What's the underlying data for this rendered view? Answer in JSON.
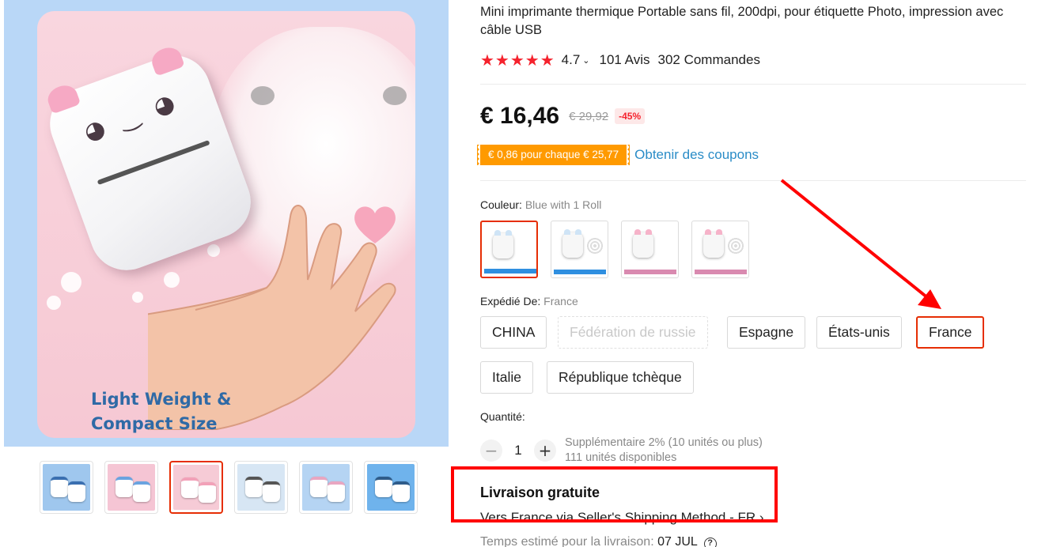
{
  "gallery": {
    "caption_line1": "Light Weight &",
    "caption_line2": "Compact Size",
    "thumbnails": [
      {
        "theme": "#9fc7ee",
        "accent": "#3a6fb0"
      },
      {
        "theme": "#f5c5d4",
        "accent": "#6aa3e0"
      },
      {
        "theme": "#f6cbd6",
        "accent": "#f2a1b8",
        "active": true
      },
      {
        "theme": "#d7e6f4",
        "accent": "#555555"
      },
      {
        "theme": "#b5d4f3",
        "accent": "#e8a6c1"
      },
      {
        "theme": "#6fb3ec",
        "accent": "#2e5c8a"
      }
    ]
  },
  "product": {
    "title": "Mini imprimante thermique Portable sans fil, 200dpi, pour étiquette Photo, impression avec câble USB",
    "stars": "★★★★★",
    "score": "4.7",
    "score_chevron": "⌄",
    "reviews": "101 Avis",
    "orders": "302 Commandes",
    "price": "€ 16,46",
    "old_price": "€ 29,92",
    "discount": "-45%",
    "coupon_tag": "€ 0,86 pour chaque € 25,77",
    "coupon_link": "Obtenir des coupons",
    "accent_color": "#e62e04",
    "rating_color": "#f5222d",
    "coupon_color": "#ff9a00",
    "link_color": "#2a8cc7"
  },
  "color": {
    "label": "Couleur:",
    "selected": "Blue with 1 Roll",
    "options": [
      {
        "ear": "#cfe4f6",
        "strip": "#2f8fe0",
        "rolls": false,
        "active": true
      },
      {
        "ear": "#cfe4f6",
        "strip": "#2f8fe0",
        "rolls": true
      },
      {
        "ear": "#f6b3c9",
        "strip": "#d98ab0",
        "rolls": false
      },
      {
        "ear": "#f6b3c9",
        "strip": "#d98ab0",
        "rolls": true
      }
    ]
  },
  "shipping_from": {
    "label": "Expédié De:",
    "selected": "France",
    "options": [
      {
        "label": "CHINA",
        "state": "normal"
      },
      {
        "label": "Fédération de russie",
        "state": "disabled"
      },
      {
        "label": "Espagne",
        "state": "normal"
      },
      {
        "label": "États-unis",
        "state": "normal"
      },
      {
        "label": "France",
        "state": "active"
      },
      {
        "label": "Italie",
        "state": "normal"
      },
      {
        "label": "République tchèque",
        "state": "normal"
      }
    ]
  },
  "quantity": {
    "label": "Quantité:",
    "value": "1",
    "minus": "−",
    "plus": "+",
    "note_line1": "Supplémentaire 2% (10 unités ou plus)",
    "note_line2": "111 unités disponibles"
  },
  "delivery": {
    "title": "Livraison gratuite",
    "method": "Vers France via Seller's Shipping Method - FR",
    "method_chevron": "›",
    "time_label": "Temps estimé pour la livraison:",
    "time_value": "07 JUL",
    "help": "?"
  },
  "annotation": {
    "color": "#ff0000"
  }
}
